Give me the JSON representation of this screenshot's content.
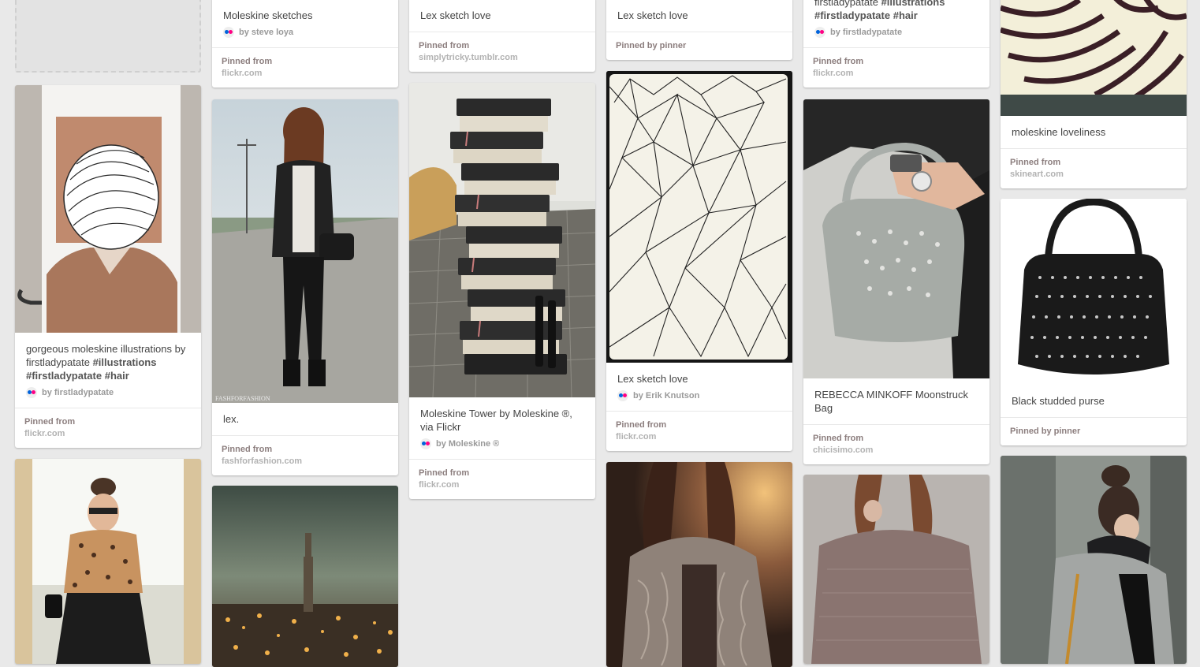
{
  "pins": {
    "c1": [
      {
        "desc": "gorgeous moleskine illustrations by firstladypatate",
        "tags": [
          "#illustrations",
          "#firstladypatate",
          "#hair"
        ],
        "by": "by firstladypatate",
        "src1": "Pinned from",
        "src2": "flickr.com"
      }
    ],
    "c2": [
      {
        "desc": "Moleskine sketches",
        "by": "by steve loya",
        "src1": "Pinned from",
        "src2": "flickr.com"
      },
      {
        "desc": "lex.",
        "src1": "Pinned from",
        "src2": "fashforfashion.com",
        "watermark": "FASHFORFASHION"
      }
    ],
    "c3": [
      {
        "desc": "Lex sketch love",
        "src1": "Pinned from",
        "src2": "simplytricky.tumblr.com"
      },
      {
        "desc": "Moleskine Tower by Moleskine ®, via Flickr",
        "by": "by Moleskine ®",
        "src1": "Pinned from",
        "src2": "flickr.com"
      }
    ],
    "c4": [
      {
        "desc": "Lex sketch love",
        "src1": "Pinned by pinner"
      },
      {
        "desc": "Lex sketch love",
        "by": "by Erik Knutson",
        "src1": "Pinned from",
        "src2": "flickr.com"
      }
    ],
    "c5": [
      {
        "desc": "firstladypatate",
        "tags": [
          "#illustrations",
          "#firstladypatate",
          "#hair"
        ],
        "by": "by firstladypatate",
        "src1": "Pinned from",
        "src2": "flickr.com"
      },
      {
        "desc": "REBECCA MINKOFF Moonstruck Bag",
        "src1": "Pinned from",
        "src2": "chicisimo.com"
      }
    ],
    "c6": [
      {
        "desc": "moleskine loveliness",
        "src1": "Pinned from",
        "src2": "skineart.com"
      },
      {
        "desc": "Black studded purse",
        "src1": "Pinned by pinner"
      }
    ]
  },
  "icons": {
    "source": "flickr-icon"
  }
}
